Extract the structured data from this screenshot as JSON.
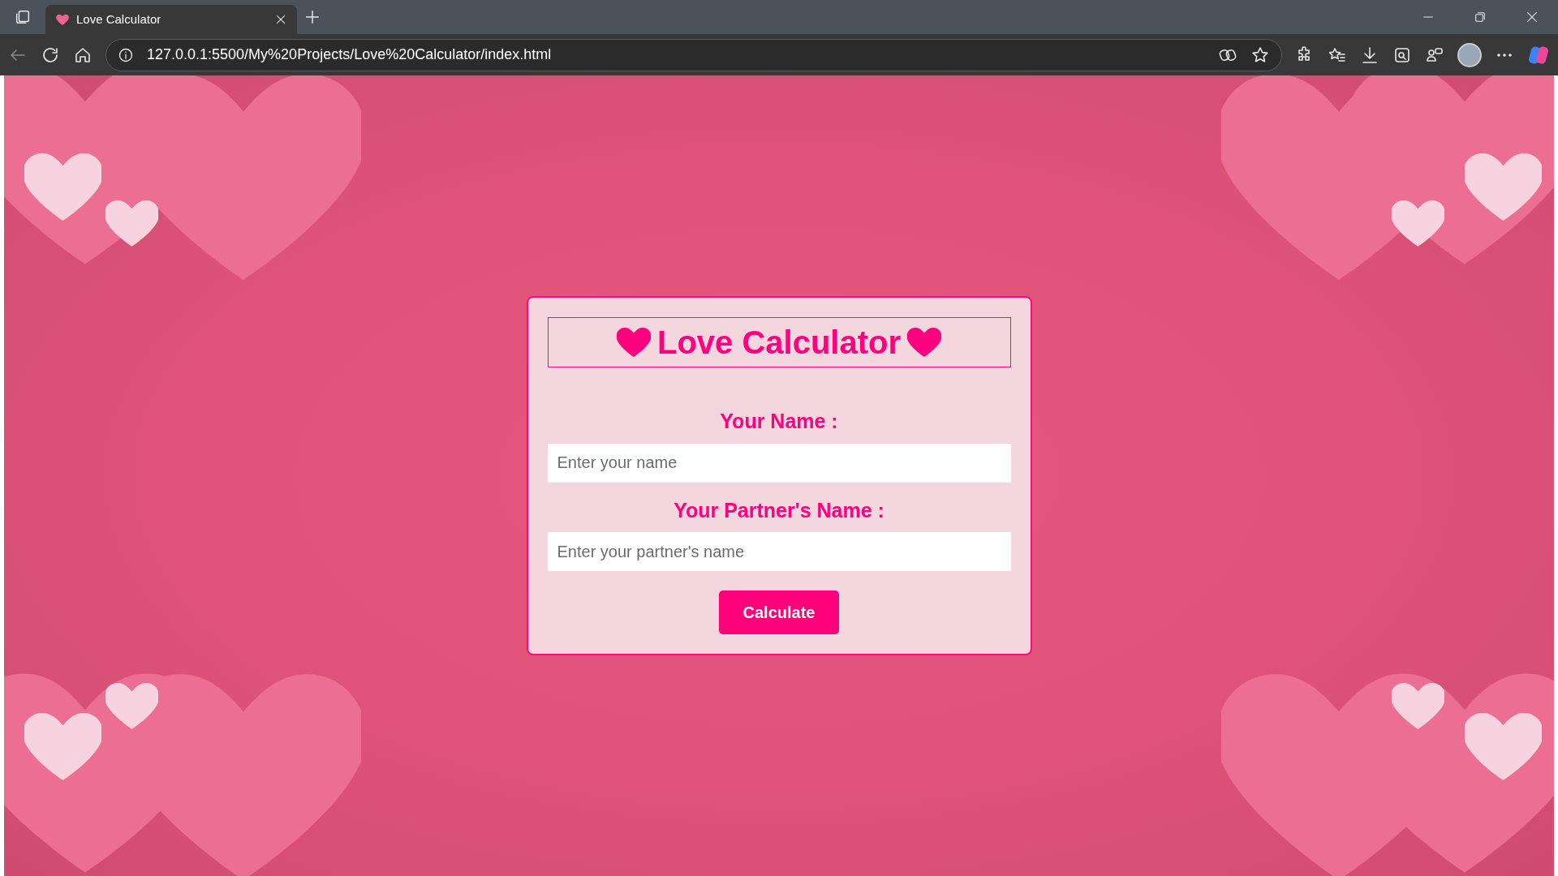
{
  "browser": {
    "tab_title": "Love Calculator",
    "address": "127.0.0.1:5500/My%20Projects/Love%20Calculator/index.html"
  },
  "page": {
    "title": "Love Calculator",
    "fields": [
      {
        "label": "Your Name :",
        "placeholder": "Enter your name"
      },
      {
        "label": "Your Partner's Name :",
        "placeholder": "Enter your partner's name"
      }
    ],
    "button": "Calculate"
  }
}
